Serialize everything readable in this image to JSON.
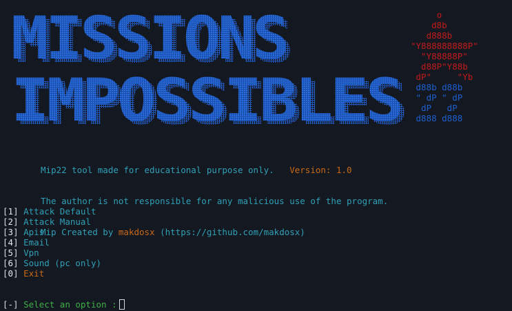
{
  "banner": {
    "line1": "MISSIONS",
    "line2": "IMPOSSIBLES",
    "color": "#1f5fd0"
  },
  "emblem": {
    "red_lines": [
      "     o",
      "    d8b",
      "   d888b",
      "\"Y888888888P\"",
      "  \"Y88888P\"",
      "  d88P\"Y88b",
      " dP\"     \"Yb"
    ],
    "blue_lines": [
      " d88b d88b",
      " \" dP \" dP",
      "  dP   dP",
      " d888 d888"
    ]
  },
  "info": {
    "tool_text": "Mip22 tool made for educational purpose only.",
    "version_text": "Version: 1.0",
    "disclaimer": "The author is not responsible for any malicious use of the program.",
    "created_by_prefix": "Mip Created by ",
    "author": "makdosx",
    "repo": "(https://github.com/makdosx)"
  },
  "menu": {
    "items": [
      {
        "num": "1",
        "label": "Attack Default"
      },
      {
        "num": "2",
        "label": "Attack Manual"
      },
      {
        "num": "3",
        "label": "Apis"
      },
      {
        "num": "4",
        "label": "Email"
      },
      {
        "num": "5",
        "label": "Vpn"
      },
      {
        "num": "6",
        "label": "Sound (pc only)"
      },
      {
        "num": "0",
        "label": "Exit"
      }
    ]
  },
  "prompt": {
    "marker": "[-]",
    "text": "Select an option :",
    "value": ""
  },
  "colors": {
    "background": "#141821",
    "teal": "#2fa0b6",
    "orange": "#c96a16",
    "green": "#3fb047",
    "red": "#c21b1b",
    "blue": "#1f5fd0"
  }
}
